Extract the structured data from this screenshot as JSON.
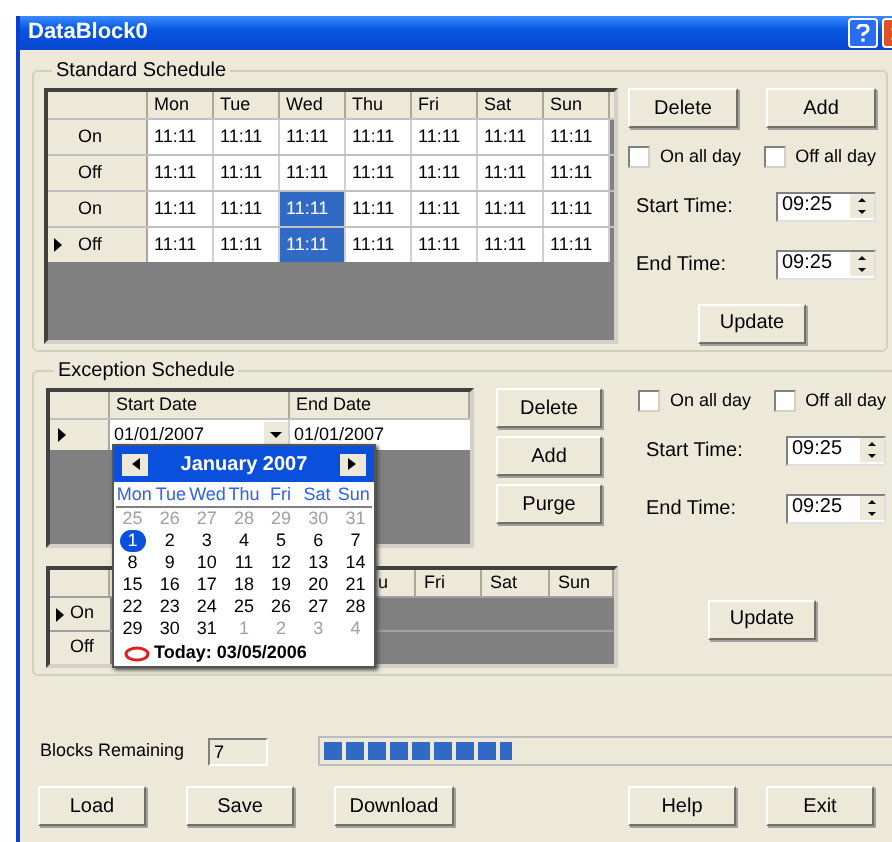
{
  "window": {
    "title": "DataBlock0"
  },
  "standard_schedule": {
    "title": "Standard Schedule",
    "columns": [
      "Mon",
      "Tue",
      "Wed",
      "Thu",
      "Fri",
      "Sat",
      "Sun"
    ],
    "rows": [
      {
        "label": "On",
        "current": false,
        "cells": [
          {
            "text": "11:11",
            "selected": false
          },
          {
            "text": "11:11",
            "selected": false
          },
          {
            "text": "11:11",
            "selected": false
          },
          {
            "text": "11:11",
            "selected": false
          },
          {
            "text": "11:11",
            "selected": false
          },
          {
            "text": "11:11",
            "selected": false
          },
          {
            "text": "11:11",
            "selected": false
          }
        ]
      },
      {
        "label": "Off",
        "current": false,
        "cells": [
          {
            "text": "11:11",
            "selected": false
          },
          {
            "text": "11:11",
            "selected": false
          },
          {
            "text": "11:11",
            "selected": false
          },
          {
            "text": "11:11",
            "selected": false
          },
          {
            "text": "11:11",
            "selected": false
          },
          {
            "text": "11:11",
            "selected": false
          },
          {
            "text": "11:11",
            "selected": false
          }
        ]
      },
      {
        "label": "On",
        "current": false,
        "cells": [
          {
            "text": "11:11",
            "selected": false
          },
          {
            "text": "11:11",
            "selected": false
          },
          {
            "text": "11:11",
            "selected": true
          },
          {
            "text": "11:11",
            "selected": false
          },
          {
            "text": "11:11",
            "selected": false
          },
          {
            "text": "11:11",
            "selected": false
          },
          {
            "text": "11:11",
            "selected": false
          }
        ]
      },
      {
        "label": "Off",
        "current": true,
        "cells": [
          {
            "text": "11:11",
            "selected": false
          },
          {
            "text": "11:11",
            "selected": false
          },
          {
            "text": "11:11",
            "selected": true
          },
          {
            "text": "11:11",
            "selected": false
          },
          {
            "text": "11:11",
            "selected": false
          },
          {
            "text": "11:11",
            "selected": false
          },
          {
            "text": "11:11",
            "selected": false
          }
        ]
      }
    ],
    "buttons": [
      "Delete",
      "Add"
    ],
    "checkboxes": [
      {
        "label": "On all day",
        "checked": false
      },
      {
        "label": "Off all day",
        "checked": false
      }
    ],
    "times": [
      {
        "label": "Start Time:",
        "value": "09:25"
      },
      {
        "label": "End Time:",
        "value": "09:25"
      }
    ],
    "update": "Update"
  },
  "exception_schedule": {
    "title": "Exception Schedule",
    "columns": [
      "Start Date",
      "End Date"
    ],
    "rows": [
      {
        "current": true,
        "start_date": "01/01/2007",
        "end_date": "01/01/2007"
      }
    ],
    "buttons": [
      "Delete",
      "Add",
      "Purge"
    ],
    "checkboxes": [
      {
        "label": "On all day",
        "checked": false
      },
      {
        "label": "Off all day",
        "checked": false
      }
    ],
    "times": [
      {
        "label": "Start Time:",
        "value": "09:25"
      },
      {
        "label": "End Time:",
        "value": "09:25"
      }
    ],
    "update": "Update",
    "day_grid": {
      "columns": [
        "u",
        "Fri",
        "Sat",
        "Sun"
      ],
      "rows": [
        {
          "label": "On",
          "current": true
        },
        {
          "label": "Off",
          "current": false
        }
      ]
    },
    "calendar": {
      "month": "January 2007",
      "weekdays": [
        "Mon",
        "Tue",
        "Wed",
        "Thu",
        "Fri",
        "Sat",
        "Sun"
      ],
      "weeks": [
        [
          {
            "day": "25",
            "other_month": true,
            "selected": false
          },
          {
            "day": "26",
            "other_month": true,
            "selected": false
          },
          {
            "day": "27",
            "other_month": true,
            "selected": false
          },
          {
            "day": "28",
            "other_month": true,
            "selected": false
          },
          {
            "day": "29",
            "other_month": true,
            "selected": false
          },
          {
            "day": "30",
            "other_month": true,
            "selected": false
          },
          {
            "day": "31",
            "other_month": true,
            "selected": false
          }
        ],
        [
          {
            "day": "1",
            "other_month": false,
            "selected": true
          },
          {
            "day": "2",
            "other_month": false,
            "selected": false
          },
          {
            "day": "3",
            "other_month": false,
            "selected": false
          },
          {
            "day": "4",
            "other_month": false,
            "selected": false
          },
          {
            "day": "5",
            "other_month": false,
            "selected": false
          },
          {
            "day": "6",
            "other_month": false,
            "selected": false
          },
          {
            "day": "7",
            "other_month": false,
            "selected": false
          }
        ],
        [
          {
            "day": "8",
            "other_month": false,
            "selected": false
          },
          {
            "day": "9",
            "other_month": false,
            "selected": false
          },
          {
            "day": "10",
            "other_month": false,
            "selected": false
          },
          {
            "day": "11",
            "other_month": false,
            "selected": false
          },
          {
            "day": "12",
            "other_month": false,
            "selected": false
          },
          {
            "day": "13",
            "other_month": false,
            "selected": false
          },
          {
            "day": "14",
            "other_month": false,
            "selected": false
          }
        ],
        [
          {
            "day": "15",
            "other_month": false,
            "selected": false
          },
          {
            "day": "16",
            "other_month": false,
            "selected": false
          },
          {
            "day": "17",
            "other_month": false,
            "selected": false
          },
          {
            "day": "18",
            "other_month": false,
            "selected": false
          },
          {
            "day": "19",
            "other_month": false,
            "selected": false
          },
          {
            "day": "20",
            "other_month": false,
            "selected": false
          },
          {
            "day": "21",
            "other_month": false,
            "selected": false
          }
        ],
        [
          {
            "day": "22",
            "other_month": false,
            "selected": false
          },
          {
            "day": "23",
            "other_month": false,
            "selected": false
          },
          {
            "day": "24",
            "other_month": false,
            "selected": false
          },
          {
            "day": "25",
            "other_month": false,
            "selected": false
          },
          {
            "day": "26",
            "other_month": false,
            "selected": false
          },
          {
            "day": "27",
            "other_month": false,
            "selected": false
          },
          {
            "day": "28",
            "other_month": false,
            "selected": false
          }
        ],
        [
          {
            "day": "29",
            "other_month": false,
            "selected": false
          },
          {
            "day": "30",
            "other_month": false,
            "selected": false
          },
          {
            "day": "31",
            "other_month": false,
            "selected": false
          },
          {
            "day": "1",
            "other_month": true,
            "selected": false
          },
          {
            "day": "2",
            "other_month": true,
            "selected": false
          },
          {
            "day": "3",
            "other_month": true,
            "selected": false
          },
          {
            "day": "4",
            "other_month": true,
            "selected": false
          }
        ]
      ],
      "today": "Today: 03/05/2006"
    }
  },
  "blocks_remaining": {
    "label": "Blocks Remaining",
    "value": "7",
    "level": 0.33
  },
  "left_buttons": [
    "Load",
    "Save",
    "Download"
  ],
  "right_buttons": [
    "Help",
    "Exit"
  ]
}
